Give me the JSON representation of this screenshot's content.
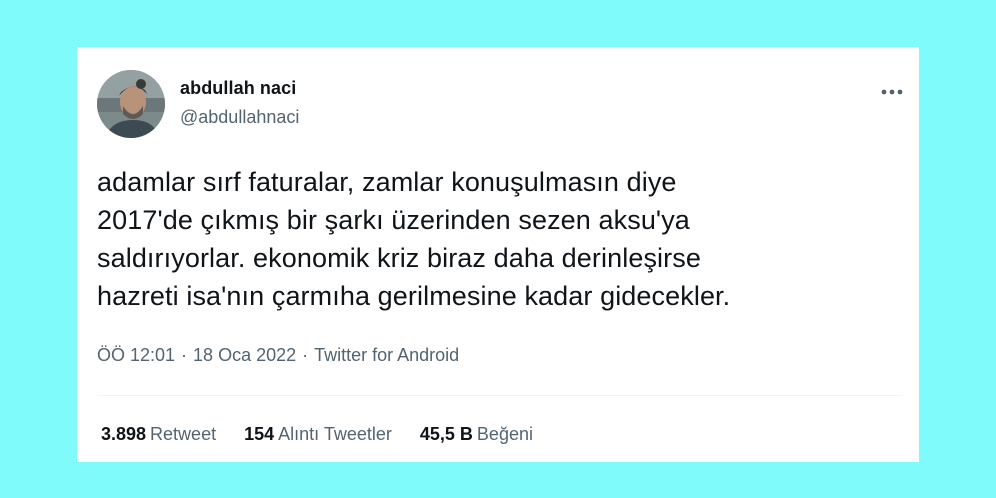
{
  "colors": {
    "page_background": "#7ffbfb",
    "card_background": "#ffffff",
    "text_primary": "#0f1419",
    "text_secondary": "#536471"
  },
  "author": {
    "name": "abdullah naci",
    "handle": "@abdullahnaci"
  },
  "tweet": {
    "text": "adamlar sırf faturalar, zamlar konuşulmasın diye\n2017'de çıkmış bir şarkı üzerinden sezen aksu'ya\nsaldırıyorlar. ekonomik kriz biraz daha derinleşirse\nhazreti isa'nın çarmıha gerilmesine kadar gidecekler."
  },
  "meta": {
    "time": "ÖÖ 12:01",
    "separator": "·",
    "date": "18 Oca 2022",
    "source": "Twitter for Android"
  },
  "stats": {
    "retweets": {
      "count": "3.898",
      "label": "Retweet"
    },
    "quotes": {
      "count": "154",
      "label": "Alıntı Tweetler"
    },
    "likes": {
      "count": "45,5 B",
      "label": "Beğeni"
    }
  },
  "icons": {
    "more": "more-options-icon",
    "avatar": "profile-photo"
  }
}
